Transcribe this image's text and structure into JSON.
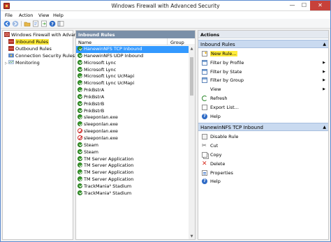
{
  "window": {
    "title": "Windows Firewall with Advanced Security",
    "minimize": "—",
    "maximize": "☐",
    "close": "✕"
  },
  "menu": [
    "File",
    "Action",
    "View",
    "Help"
  ],
  "tree": {
    "root": "Windows Firewall with Advance",
    "items": [
      "Inbound Rules",
      "Outbound Rules",
      "Connection Security Rules",
      "Monitoring"
    ]
  },
  "inbound_rules": {
    "header": "Inbound Rules",
    "columns": {
      "name": "Name",
      "group": "Group"
    },
    "rows": [
      {
        "name": "HanewinNFS TCP Inbound",
        "icon": "allow",
        "selected": true
      },
      {
        "name": "HanewinNFS UDP Inbound",
        "icon": "allow"
      },
      {
        "name": "Microsoft Lync",
        "icon": "allow"
      },
      {
        "name": "Microsoft Lync",
        "icon": "allow"
      },
      {
        "name": "Microsoft Lync UcMapi",
        "icon": "allow"
      },
      {
        "name": "Microsoft Lync UcMapi",
        "icon": "allow"
      },
      {
        "name": "PnkBstrA",
        "icon": "allow"
      },
      {
        "name": "PnkBstrA",
        "icon": "allow"
      },
      {
        "name": "PnkBstrB",
        "icon": "allow"
      },
      {
        "name": "PnkBstrB",
        "icon": "allow"
      },
      {
        "name": "sleeponlan.exe",
        "icon": "allow"
      },
      {
        "name": "sleeponlan.exe",
        "icon": "allow"
      },
      {
        "name": "sleeponlan.exe",
        "icon": "block"
      },
      {
        "name": "sleeponlan.exe",
        "icon": "block"
      },
      {
        "name": "Steam",
        "icon": "allow"
      },
      {
        "name": "Steam",
        "icon": "allow"
      },
      {
        "name": "TM Server Application",
        "icon": "allow"
      },
      {
        "name": "TM Server Application",
        "icon": "allow"
      },
      {
        "name": "TM Server Application",
        "icon": "allow"
      },
      {
        "name": "TM Server Application",
        "icon": "allow"
      },
      {
        "name": "TrackMania² Stadium",
        "icon": "allow"
      },
      {
        "name": "TrackMania² Stadium",
        "icon": "allow"
      }
    ]
  },
  "actions": {
    "title": "Actions",
    "sections": [
      {
        "header": "Inbound Rules",
        "items": [
          {
            "label": "New Rule...",
            "icon": "new-rule-icon",
            "submenu": false
          },
          {
            "label": "Filter by Profile",
            "icon": "filter-icon",
            "submenu": true
          },
          {
            "label": "Filter by State",
            "icon": "filter-icon",
            "submenu": true
          },
          {
            "label": "Filter by Group",
            "icon": "filter-icon",
            "submenu": true
          },
          {
            "label": "View",
            "icon": "",
            "submenu": true
          },
          {
            "label": "Refresh",
            "icon": "refresh-icon",
            "submenu": false
          },
          {
            "label": "Export List...",
            "icon": "export-icon",
            "submenu": false
          },
          {
            "label": "Help",
            "icon": "help-icon",
            "submenu": false
          }
        ]
      },
      {
        "header": "HanewinNFS TCP Inbound",
        "items": [
          {
            "label": "Disable Rule",
            "icon": "disable-icon",
            "submenu": false
          },
          {
            "label": "Cut",
            "icon": "cut-icon",
            "submenu": false
          },
          {
            "label": "Copy",
            "icon": "copy-icon",
            "submenu": false
          },
          {
            "label": "Delete",
            "icon": "delete-icon",
            "submenu": false
          },
          {
            "label": "Properties",
            "icon": "properties-icon",
            "submenu": false
          },
          {
            "label": "Help",
            "icon": "help-icon",
            "submenu": false
          }
        ]
      }
    ]
  },
  "colors": {
    "selection": "#3399ff",
    "highlight": "#ffeb3b",
    "pane_header": "#7a8fa8",
    "section_header": "#c9daf0"
  }
}
